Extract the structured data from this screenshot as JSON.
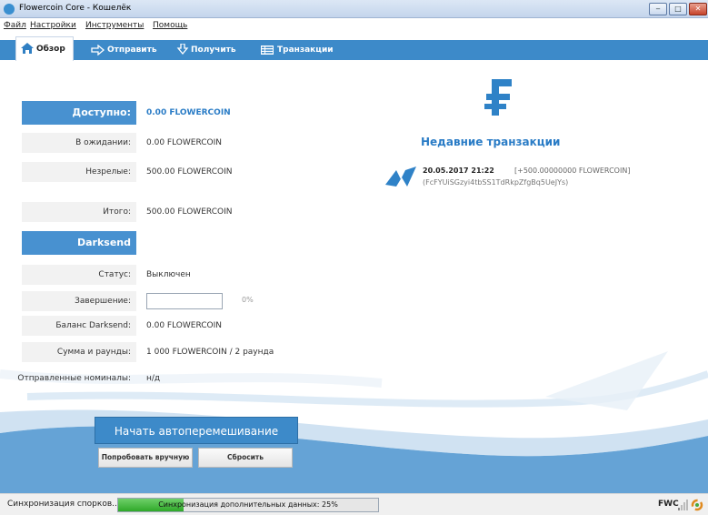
{
  "window": {
    "title": "Flowercoin Core - Кошелёк",
    "minimize": "‒",
    "maximize": "□",
    "close": "✕"
  },
  "menu": [
    "Файл",
    "Настройки",
    "Инструменты",
    "Помощь"
  ],
  "tabs": [
    {
      "label": "Обзор",
      "icon": "home-icon",
      "active": true
    },
    {
      "label": "Отправить",
      "icon": "send-arrow-icon"
    },
    {
      "label": "Получить",
      "icon": "receive-arrow-icon"
    },
    {
      "label": "Транзакции",
      "icon": "transactions-list-icon"
    }
  ],
  "balances": {
    "available_label": "Доступно:",
    "available_value": "0.00 FLOWERCOIN",
    "pending_label": "В ожидании:",
    "pending_value": "0.00 FLOWERCOIN",
    "immature_label": "Незрелые:",
    "immature_value": "500.00 FLOWERCOIN",
    "total_label": "Итого:",
    "total_value": "500.00 FLOWERCOIN"
  },
  "darksend": {
    "header": "Darksend",
    "status_label": "Статус:",
    "status_value": "Выключен",
    "completion_label": "Завершение:",
    "completion_percent": "0%",
    "balance_label": "Баланс Darksend:",
    "balance_value": "0.00 FLOWERCOIN",
    "amount_label": "Сумма и раунды:",
    "amount_value": "1 000 FLOWERCOIN / 2 раунда",
    "denoms_label": "Отправленные номиналы:",
    "denoms_value": "н/д",
    "start_button": "Начать автоперемешивание",
    "try_manual_button": "Попробовать вручную",
    "reset_button": "Сбросить"
  },
  "recent": {
    "title": "Недавние транзакции",
    "transactions": [
      {
        "date": "20.05.2017 21:22",
        "amount": "[+500.00000000 FLOWERCOIN]",
        "address": "(FcFYUiSGzyi4tbSS1TdRkpZfgBq5UeJYs)"
      }
    ]
  },
  "status": {
    "sync_label": "Синхронизация спорков...",
    "progress_text": "Синхронизация дополнительных данных: 25%",
    "progress": 0.25,
    "unit": "FWC"
  },
  "colors": {
    "accent": "#3d8ac9",
    "link": "#2a7cc6",
    "progress": "#2fa829"
  }
}
